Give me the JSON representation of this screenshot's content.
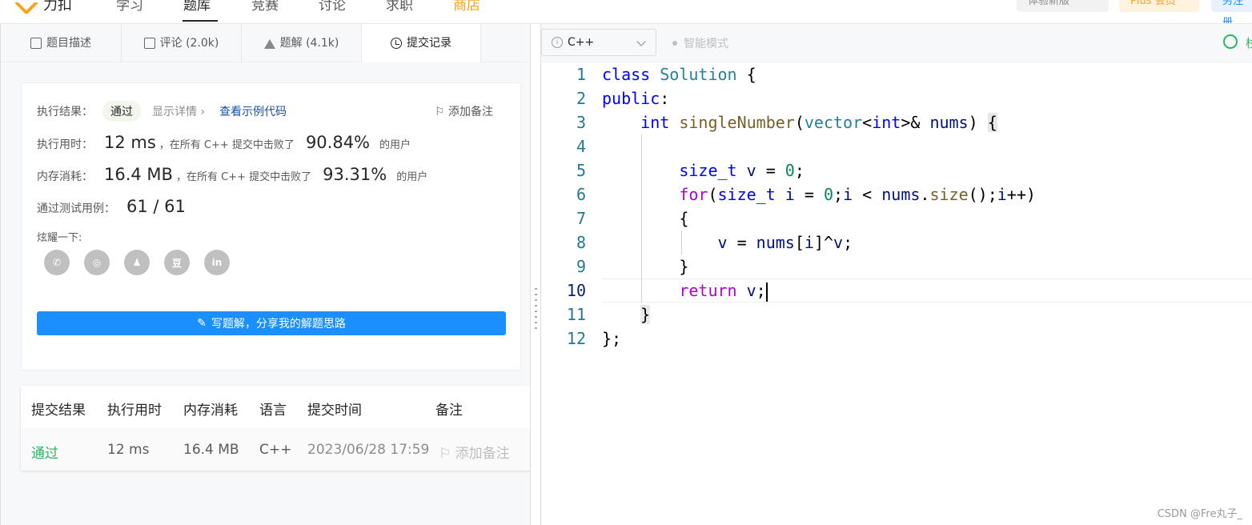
{
  "topnav": {
    "logo_text": "力扣",
    "items": [
      "学习",
      "题库",
      "竞赛",
      "讨论",
      "求职",
      "商店"
    ],
    "try_new": "体验新版",
    "plus": "Plus 会员",
    "register": "另注册"
  },
  "tabs": [
    {
      "label": "题目描述",
      "icon": "document-icon"
    },
    {
      "label": "评论 (2.0k)",
      "icon": "comment-icon"
    },
    {
      "label": "题解 (4.1k)",
      "icon": "flask-icon"
    },
    {
      "label": "提交记录",
      "icon": "clock-icon"
    }
  ],
  "result": {
    "exec_result_label": "执行结果：",
    "status": "通过",
    "show_detail": "显示详情 ›",
    "view_sample": "查看示例代码",
    "add_note": "添加备注",
    "time_label": "执行用时：",
    "time_value": "12 ms",
    "time_text": "，在所有 C++ 提交中击败了",
    "time_pct": "90.84%",
    "users": "的用户",
    "mem_label": "内存消耗：",
    "mem_value": "16.4 MB",
    "mem_text": "，在所有 C++ 提交中击败了",
    "mem_pct": "93.31%",
    "tests_label": "通过测试用例：",
    "tests_value": "61 / 61",
    "share_label": "炫耀一下:",
    "share_icons": [
      "wechat-icon",
      "weibo-icon",
      "qq-icon",
      "douban-icon",
      "linkedin-icon"
    ],
    "share_glyphs": [
      "✆",
      "◎",
      "♟",
      "豆",
      "in"
    ],
    "write_button": "写题解，分享我的解题思路"
  },
  "submissions": {
    "headers": [
      "提交结果",
      "执行用时",
      "内存消耗",
      "语言",
      "提交时间",
      "备注"
    ],
    "rows": [
      {
        "result": "通过",
        "time": "12 ms",
        "memory": "16.4 MB",
        "lang": "C++",
        "submitted": "2023/06/28 17:59",
        "note": "添加备注"
      }
    ]
  },
  "editor": {
    "language": "C++",
    "smart_mode": "智能模式",
    "timer_partial": "栈",
    "line_numbers": [
      "1",
      "2",
      "3",
      "4",
      "5",
      "6",
      "7",
      "8",
      "9",
      "10",
      "11",
      "12"
    ],
    "current_line": 10
  },
  "watermark": "CSDN @Fre丸子_",
  "colors": {
    "accent_blue": "#1a90ff",
    "pass_green": "#2db55d",
    "brand_orange": "#ffa116"
  }
}
